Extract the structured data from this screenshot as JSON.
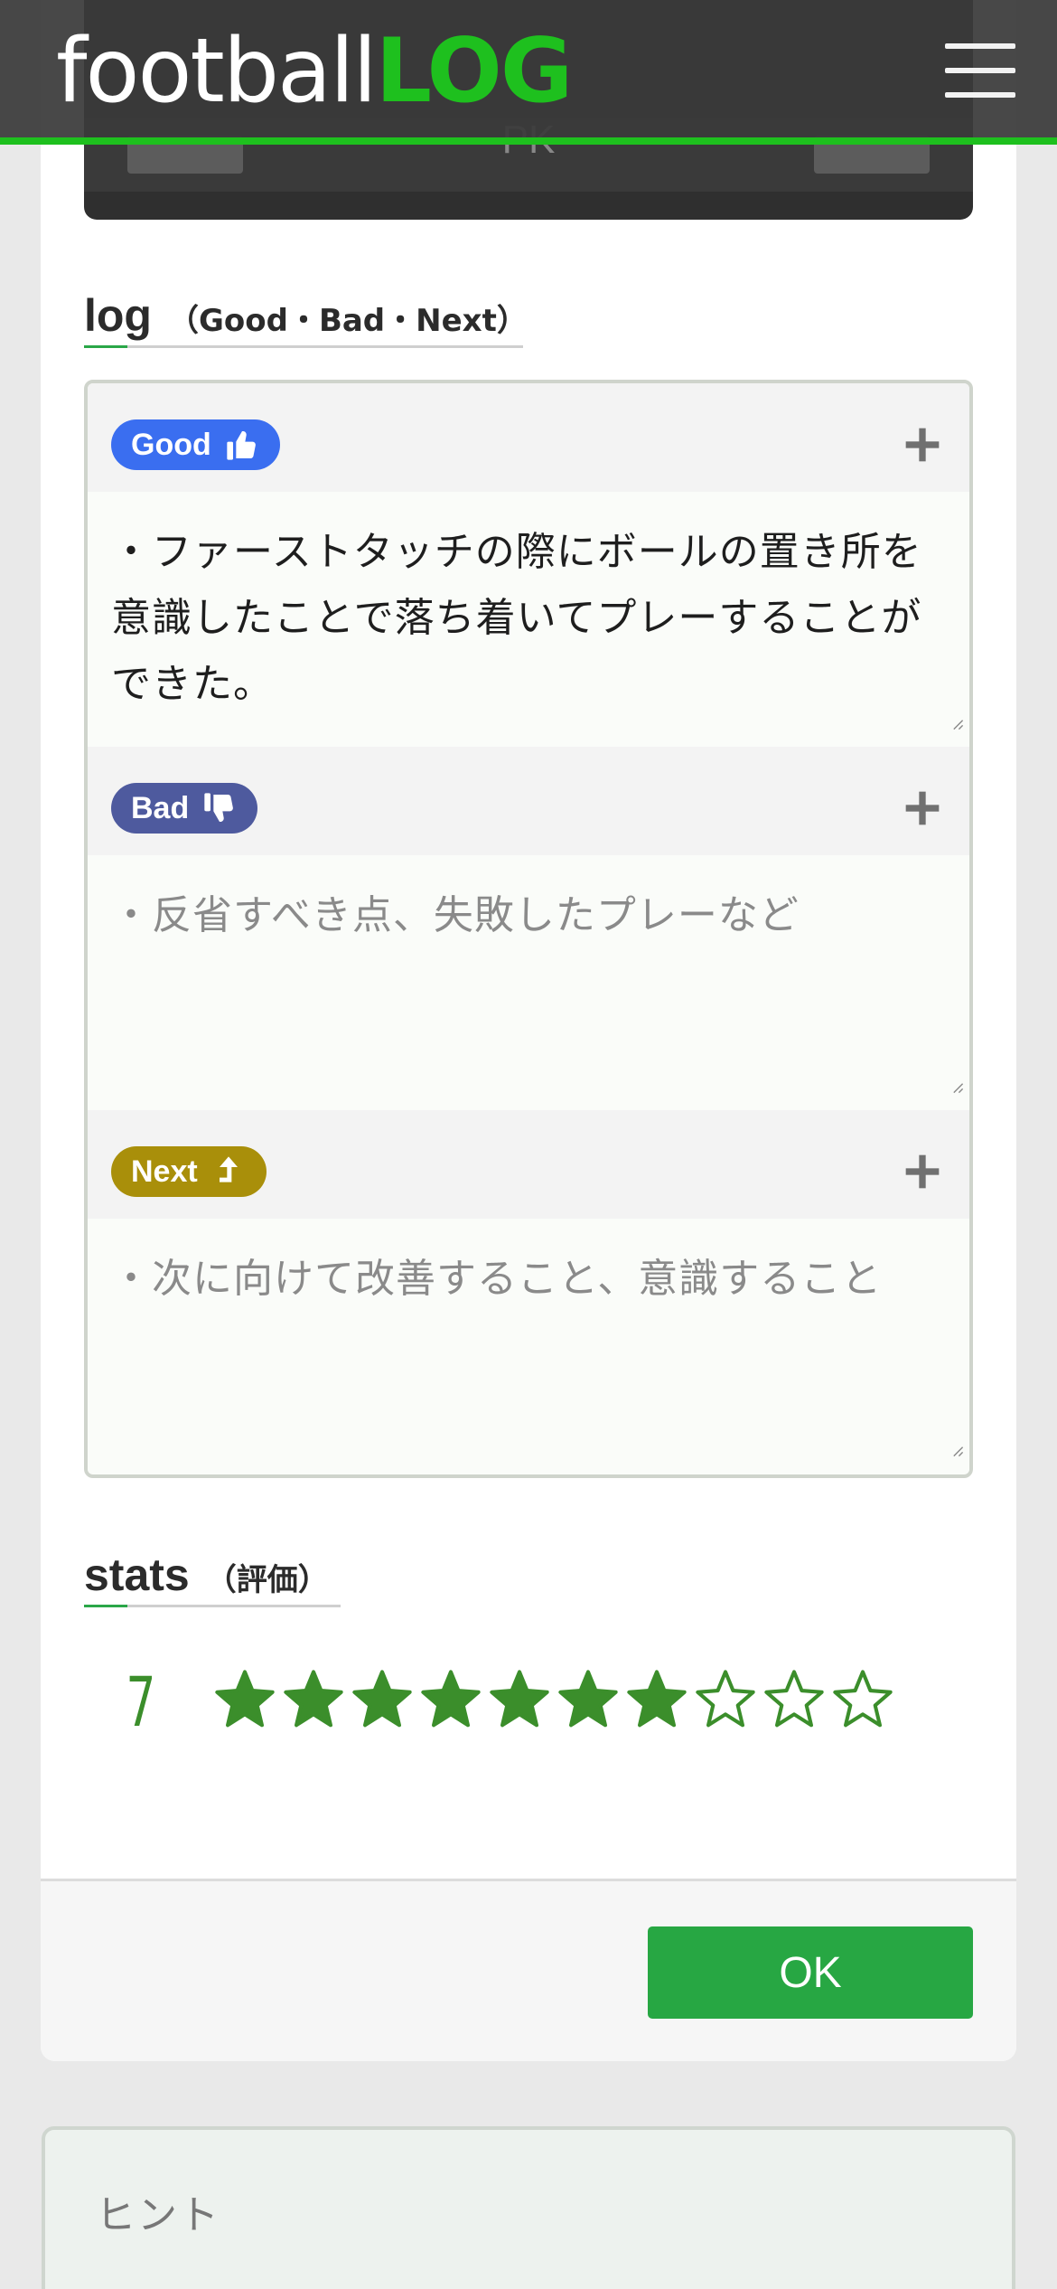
{
  "header": {
    "logo_part1": "football",
    "logo_part2": "LOG",
    "menu_icon": "hamburger-icon"
  },
  "score_panel": {
    "pk_label": "PK"
  },
  "log_section": {
    "title": "log",
    "subtitle": "（Good・Bad・Next）",
    "rows": [
      {
        "label": "Good",
        "icon": "thumbs-up-icon",
        "value": "・ファーストタッチの際にボールの置き所を意識したことで落ち着いてプレーすることができた。",
        "placeholder": ""
      },
      {
        "label": "Bad",
        "icon": "thumbs-down-icon",
        "value": "",
        "placeholder": "・反省すべき点、失敗したプレーなど"
      },
      {
        "label": "Next",
        "icon": "arrow-up-icon",
        "value": "",
        "placeholder": "・次に向けて改善すること、意識すること"
      }
    ]
  },
  "stats_section": {
    "title": "stats",
    "subtitle": "（評価）",
    "rating": "7",
    "rating_value": 7,
    "rating_max": 10
  },
  "footer": {
    "ok_label": "OK"
  },
  "hint": {
    "title": "ヒント"
  },
  "colors": {
    "brand_green": "#1ec01e",
    "ok_green": "#27a743",
    "star_green": "#3b8e2b",
    "good": "#3a6ef0",
    "bad": "#4e5a9e",
    "next": "#a98f0a"
  }
}
